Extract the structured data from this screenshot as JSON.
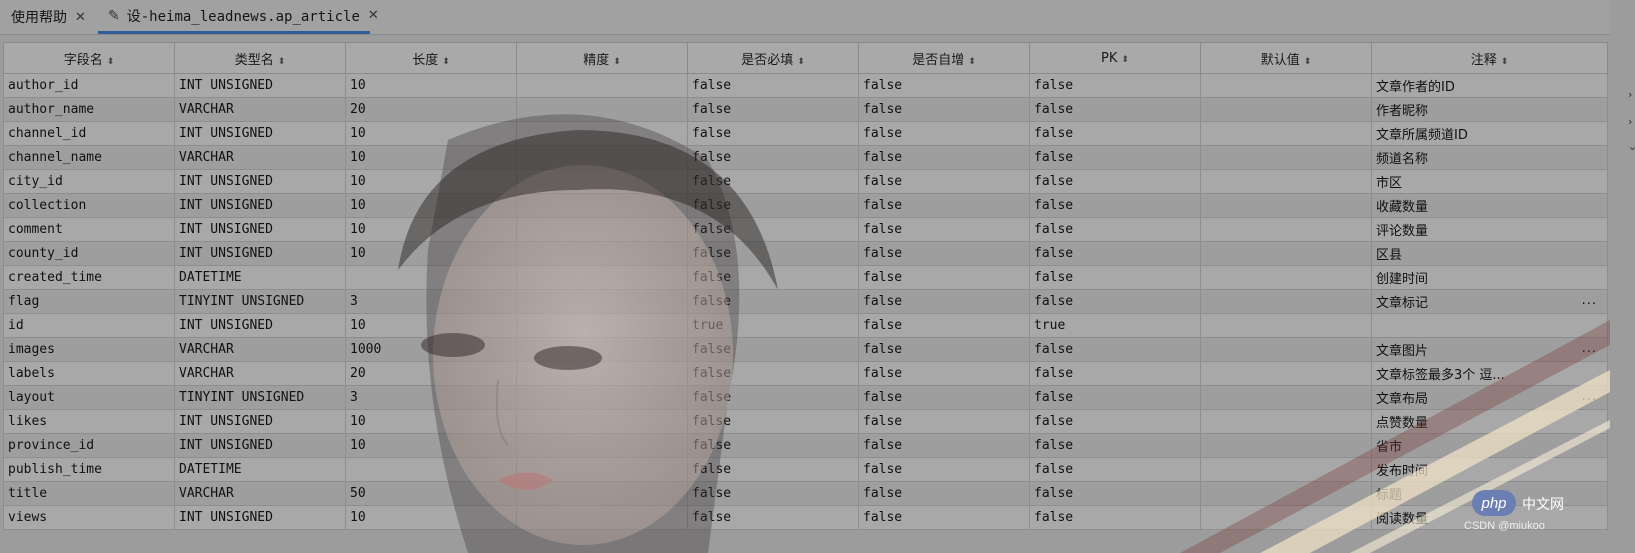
{
  "tabs": [
    {
      "label": "使用帮助",
      "active": false
    },
    {
      "label": "设-heima_leadnews.ap_article",
      "active": true
    }
  ],
  "icons": {
    "tab_close": "close-icon",
    "tab_edit": "pencil-icon",
    "sort": "sort-icon"
  },
  "table": {
    "columns": [
      "字段名",
      "类型名",
      "长度",
      "精度",
      "是否必填",
      "是否自增",
      "PK",
      "默认值",
      "注释"
    ],
    "rows": [
      {
        "name": "author_id",
        "type": "INT UNSIGNED",
        "length": "10",
        "precision": "",
        "required": "false",
        "auto": "false",
        "pk": "false",
        "default": "",
        "comment": "文章作者的ID",
        "more": ""
      },
      {
        "name": "author_name",
        "type": "VARCHAR",
        "length": "20",
        "precision": "",
        "required": "false",
        "auto": "false",
        "pk": "false",
        "default": "",
        "comment": "作者昵称",
        "more": ""
      },
      {
        "name": "channel_id",
        "type": "INT UNSIGNED",
        "length": "10",
        "precision": "",
        "required": "false",
        "auto": "false",
        "pk": "false",
        "default": "",
        "comment": "文章所属频道ID",
        "more": ""
      },
      {
        "name": "channel_name",
        "type": "VARCHAR",
        "length": "10",
        "precision": "",
        "required": "false",
        "auto": "false",
        "pk": "false",
        "default": "",
        "comment": "频道名称",
        "more": ""
      },
      {
        "name": "city_id",
        "type": "INT UNSIGNED",
        "length": "10",
        "precision": "",
        "required": "false",
        "auto": "false",
        "pk": "false",
        "default": "",
        "comment": "市区",
        "more": ""
      },
      {
        "name": "collection",
        "type": "INT UNSIGNED",
        "length": "10",
        "precision": "",
        "required": "false",
        "auto": "false",
        "pk": "false",
        "default": "",
        "comment": "收藏数量",
        "more": ""
      },
      {
        "name": "comment",
        "type": "INT UNSIGNED",
        "length": "10",
        "precision": "",
        "required": "false",
        "auto": "false",
        "pk": "false",
        "default": "",
        "comment": "评论数量",
        "more": ""
      },
      {
        "name": "county_id",
        "type": "INT UNSIGNED",
        "length": "10",
        "precision": "",
        "required": "false",
        "auto": "false",
        "pk": "false",
        "default": "",
        "comment": "区县",
        "more": ""
      },
      {
        "name": "created_time",
        "type": "DATETIME",
        "length": "",
        "precision": "",
        "required": "false",
        "auto": "false",
        "pk": "false",
        "default": "",
        "comment": "创建时间",
        "more": ""
      },
      {
        "name": "flag",
        "type": "TINYINT UNSIGNED",
        "length": "3",
        "precision": "",
        "required": "false",
        "auto": "false",
        "pk": "false",
        "default": "",
        "comment": "文章标记",
        "more": "..."
      },
      {
        "name": "id",
        "type": "INT UNSIGNED",
        "length": "10",
        "precision": "",
        "required": "true",
        "auto": "false",
        "pk": "true",
        "default": "",
        "comment": "",
        "more": ""
      },
      {
        "name": "images",
        "type": "VARCHAR",
        "length": "1000",
        "precision": "",
        "required": "false",
        "auto": "false",
        "pk": "false",
        "default": "",
        "comment": "文章图片",
        "more": "..."
      },
      {
        "name": "labels",
        "type": "VARCHAR",
        "length": "20",
        "precision": "",
        "required": "false",
        "auto": "false",
        "pk": "false",
        "default": "",
        "comment": "文章标签最多3个 逗...",
        "more": ""
      },
      {
        "name": "layout",
        "type": "TINYINT UNSIGNED",
        "length": "3",
        "precision": "",
        "required": "false",
        "auto": "false",
        "pk": "false",
        "default": "",
        "comment": "文章布局",
        "more": "..."
      },
      {
        "name": "likes",
        "type": "INT UNSIGNED",
        "length": "10",
        "precision": "",
        "required": "false",
        "auto": "false",
        "pk": "false",
        "default": "",
        "comment": "点赞数量",
        "more": ""
      },
      {
        "name": "province_id",
        "type": "INT UNSIGNED",
        "length": "10",
        "precision": "",
        "required": "false",
        "auto": "false",
        "pk": "false",
        "default": "",
        "comment": "省市",
        "more": ""
      },
      {
        "name": "publish_time",
        "type": "DATETIME",
        "length": "",
        "precision": "",
        "required": "false",
        "auto": "false",
        "pk": "false",
        "default": "",
        "comment": "发布时间",
        "more": ""
      },
      {
        "name": "title",
        "type": "VARCHAR",
        "length": "50",
        "precision": "",
        "required": "false",
        "auto": "false",
        "pk": "false",
        "default": "",
        "comment": "标题",
        "more": ""
      },
      {
        "name": "views",
        "type": "INT UNSIGNED",
        "length": "10",
        "precision": "",
        "required": "false",
        "auto": "false",
        "pk": "false",
        "default": "",
        "comment": "阅读数量",
        "more": ""
      }
    ]
  },
  "watermark": {
    "logo": "php",
    "cn": "中文网",
    "csdn": "CSDN @miukoo"
  },
  "side_markers": [
    "›",
    "›",
    "⌄"
  ],
  "colors": {
    "tab_accent": "#2f5d9a",
    "background": "#9c9c9c"
  }
}
